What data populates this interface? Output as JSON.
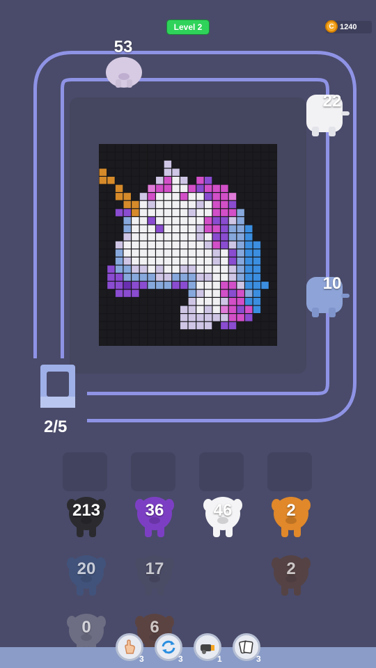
{
  "header": {
    "level_label": "Level 2",
    "coins": "1240",
    "coin_symbol": "C"
  },
  "track_shooters": [
    {
      "id": "top-left-pig",
      "count": "53",
      "color": "#d7cbe3"
    },
    {
      "id": "right-top-pig",
      "count": "22",
      "color": "#f2f2f5"
    },
    {
      "id": "right-mid-pig",
      "count": "10",
      "color": "#8ea4d8"
    }
  ],
  "queue_counter": "2/5",
  "waiting_slots": 4,
  "pig_grid": [
    {
      "count": "213",
      "color": "#2b2b2f",
      "faded": false
    },
    {
      "count": "36",
      "color": "#7c3fc4",
      "faded": false
    },
    {
      "count": "46",
      "color": "#f4f4f6",
      "faded": false
    },
    {
      "count": "2",
      "color": "#e0882a",
      "faded": false
    },
    {
      "count": "20",
      "color": "#3a5a8a",
      "faded": true
    },
    {
      "count": "17",
      "color": "#4b4c60",
      "faded": true
    },
    {
      "count": "2",
      "color": "#5e3b26",
      "faded": true
    },
    {
      "count": "0",
      "color": "#8a8b98",
      "faded": true
    },
    {
      "count": "6",
      "color": "#6a3e22",
      "faded": true
    }
  ],
  "boosters": [
    {
      "name": "tap-hand",
      "count": "3",
      "icon": "hand-icon"
    },
    {
      "name": "shuffle",
      "count": "3",
      "icon": "refresh-icon"
    },
    {
      "name": "cannon",
      "count": "1",
      "icon": "cannon-icon"
    },
    {
      "name": "cards",
      "count": "3",
      "icon": "cards-icon"
    }
  ],
  "colors": {
    "black": "#1b1b1f",
    "purple_dark": "#6a2fb0",
    "purple": "#8a4cd0",
    "magenta": "#d24fc8",
    "pink": "#e07ad8",
    "white": "#f1f1f4",
    "lavender": "#cfc6e6",
    "blue": "#3b8ee0",
    "light_blue": "#86a8dc",
    "orange": "#d68a2a"
  }
}
